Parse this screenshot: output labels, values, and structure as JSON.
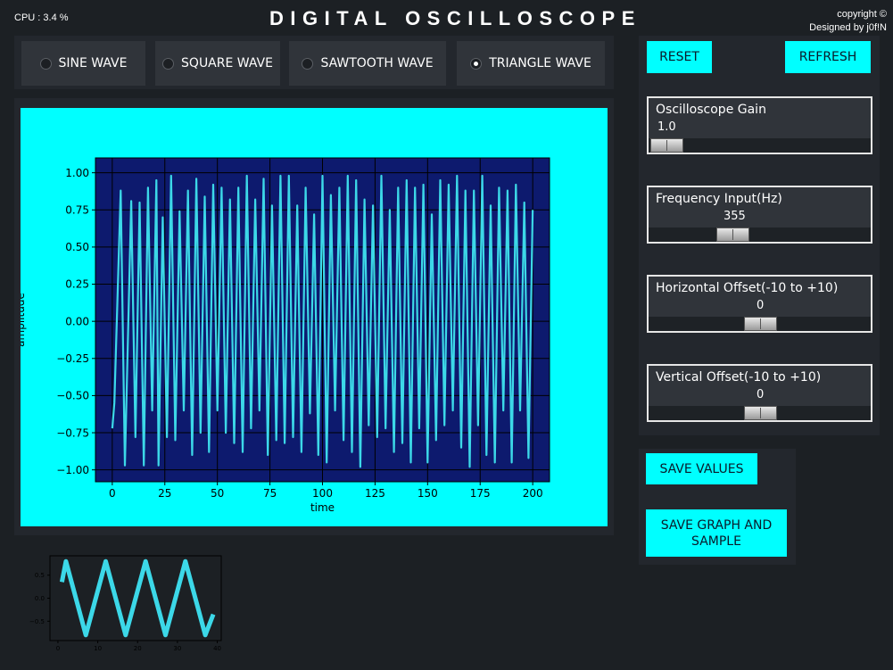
{
  "header": {
    "cpu": "CPU : 3.4 %",
    "title": "DIGITAL OSCILLOSCOPE",
    "copyright": "copyright ©",
    "designer": "Designed by j0f!N"
  },
  "wave_options": [
    {
      "label": "SINE WAVE",
      "selected": false
    },
    {
      "label": "SQUARE WAVE",
      "selected": false
    },
    {
      "label": "SAWTOOTH WAVE",
      "selected": false
    },
    {
      "label": "TRIANGLE WAVE",
      "selected": true
    }
  ],
  "buttons": {
    "reset": "RESET",
    "refresh": "REFRESH",
    "save_values": "SAVE VALUES",
    "save_graph": "SAVE GRAPH AND SAMPLE"
  },
  "sliders": {
    "gain": {
      "label": "Oscilloscope Gain",
      "value": "1.0"
    },
    "frequency": {
      "label": "Frequency Input(Hz)",
      "value": "355"
    },
    "h_offset": {
      "label": "Horizontal Offset(-10 to +10)",
      "value": "0"
    },
    "v_offset": {
      "label": "Vertical Offset(-10 to +10)",
      "value": "0"
    }
  },
  "colors": {
    "accent": "#00ffff",
    "plot_bg": "#0d1a6e",
    "trace": "#3cd8e8",
    "window_bg": "#1c2024"
  },
  "chart_data": [
    {
      "type": "line",
      "xlabel": "time",
      "ylabel": "amplitude",
      "xlim": [
        -8,
        208
      ],
      "ylim": [
        -1.08,
        1.1
      ],
      "x_ticks": [
        0,
        25,
        50,
        75,
        100,
        125,
        150,
        175,
        200
      ],
      "y_ticks": [
        1.0,
        0.75,
        0.5,
        0.25,
        0.0,
        -0.25,
        -0.5,
        -0.75,
        -1.0
      ],
      "x_tick_labels": [
        "0",
        "25",
        "50",
        "75",
        "100",
        "125",
        "150",
        "175",
        "200"
      ],
      "y_tick_labels": [
        "1.00",
        "0.75",
        "0.50",
        "0.25",
        "0.00",
        "−0.25",
        "−0.50",
        "−0.75",
        "−1.00"
      ],
      "grid": true,
      "series": [
        {
          "x": [
            0,
            1,
            4,
            6,
            9,
            11,
            13,
            15,
            17,
            19,
            21,
            22,
            24,
            26,
            28,
            30,
            32,
            34,
            36,
            38,
            40,
            42,
            44,
            46,
            48,
            50,
            52,
            54,
            56,
            58,
            60,
            62,
            64,
            66,
            68,
            70,
            72,
            74,
            76,
            78,
            80,
            82,
            84,
            86,
            88,
            90,
            92,
            94,
            96,
            98,
            100,
            102,
            104,
            106,
            108,
            110,
            112,
            114,
            116,
            118,
            120,
            122,
            124,
            126,
            128,
            130,
            132,
            134,
            136,
            138,
            140,
            142,
            144,
            146,
            148,
            150,
            152,
            154,
            156,
            158,
            160,
            162,
            164,
            166,
            168,
            170,
            172,
            174,
            176,
            178,
            180,
            182,
            184,
            186,
            188,
            190,
            192,
            194,
            196,
            198,
            200
          ],
          "y": [
            -0.72,
            -0.55,
            0.88,
            -0.97,
            0.81,
            -0.78,
            0.8,
            -0.97,
            0.9,
            -0.6,
            0.95,
            -0.97,
            0.7,
            -0.78,
            0.98,
            -0.8,
            0.74,
            -0.6,
            0.88,
            -0.9,
            0.96,
            -0.75,
            0.84,
            -0.88,
            0.92,
            -0.6,
            0.9,
            -0.75,
            0.82,
            -0.82,
            0.9,
            -0.88,
            0.98,
            -0.72,
            0.82,
            -0.6,
            0.96,
            -0.9,
            0.78,
            -0.8,
            0.98,
            -0.82,
            0.98,
            -0.78,
            0.78,
            -0.88,
            0.9,
            -0.62,
            0.72,
            -0.9,
            0.98,
            -0.95,
            0.85,
            -0.6,
            0.9,
            -0.8,
            0.98,
            -0.88,
            0.95,
            -0.98,
            0.82,
            -0.7,
            0.78,
            -0.78,
            0.98,
            -0.72,
            0.75,
            -0.88,
            0.9,
            -0.82,
            0.95,
            -0.95,
            0.9,
            -0.72,
            0.92,
            -0.95,
            0.72,
            -0.8,
            0.95,
            -0.7,
            0.92,
            -0.6,
            0.98,
            -0.85,
            0.88,
            -0.98,
            0.88,
            -0.7,
            0.98,
            -0.9,
            0.78,
            -0.95,
            0.9,
            -0.6,
            0.88,
            -0.95,
            0.92,
            -0.6,
            0.8,
            -0.92,
            0.75
          ]
        }
      ]
    },
    {
      "type": "line",
      "title": "",
      "xlim": [
        -2,
        41
      ],
      "ylim": [
        -0.92,
        0.92
      ],
      "x_ticks": [
        0,
        10,
        20,
        30,
        40
      ],
      "y_ticks": [
        0.5,
        0.0,
        -0.5
      ],
      "x_tick_labels": [
        "0",
        "10",
        "20",
        "30",
        "40"
      ],
      "y_tick_labels": [
        "0.5",
        "0.0",
        "−0.5"
      ],
      "series": [
        {
          "x": [
            1,
            2,
            7,
            12,
            17,
            22,
            27,
            32,
            37,
            39
          ],
          "y": [
            0.35,
            0.8,
            -0.8,
            0.8,
            -0.8,
            0.8,
            -0.8,
            0.8,
            -0.8,
            -0.35
          ]
        }
      ]
    }
  ]
}
